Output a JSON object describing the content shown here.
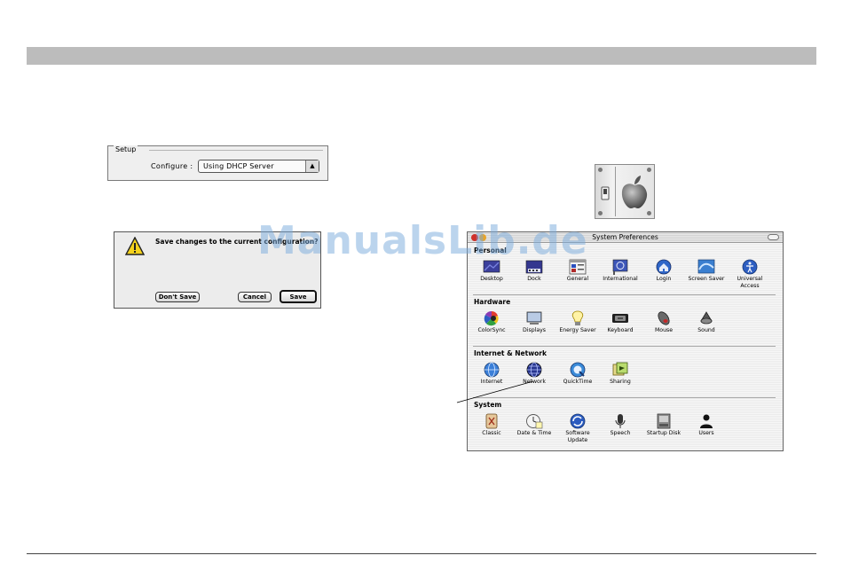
{
  "watermark": "ManualsLib.de",
  "setup": {
    "legend": "Setup",
    "configure_label": "Configure :",
    "configure_value": "Using DHCP Server"
  },
  "alert": {
    "message": "Save changes to the current configuration?",
    "dont_save": "Don't Save",
    "cancel": "Cancel",
    "save": "Save"
  },
  "sysprefs": {
    "title": "System Preferences",
    "sections": [
      {
        "title": "Personal",
        "items": [
          {
            "label": "Desktop",
            "icon": "desktop-icon"
          },
          {
            "label": "Dock",
            "icon": "dock-icon"
          },
          {
            "label": "General",
            "icon": "general-icon"
          },
          {
            "label": "International",
            "icon": "international-icon"
          },
          {
            "label": "Login",
            "icon": "login-icon"
          },
          {
            "label": "Screen Saver",
            "icon": "screen-saver-icon"
          },
          {
            "label": "Universal Access",
            "icon": "universal-access-icon"
          }
        ]
      },
      {
        "title": "Hardware",
        "items": [
          {
            "label": "ColorSync",
            "icon": "colorsync-icon"
          },
          {
            "label": "Displays",
            "icon": "displays-icon"
          },
          {
            "label": "Energy Saver",
            "icon": "energy-saver-icon"
          },
          {
            "label": "Keyboard",
            "icon": "keyboard-icon"
          },
          {
            "label": "Mouse",
            "icon": "mouse-icon"
          },
          {
            "label": "Sound",
            "icon": "sound-icon"
          }
        ]
      },
      {
        "title": "Internet & Network",
        "items": [
          {
            "label": "Internet",
            "icon": "internet-icon"
          },
          {
            "label": "Network",
            "icon": "network-icon"
          },
          {
            "label": "QuickTime",
            "icon": "quicktime-icon"
          },
          {
            "label": "Sharing",
            "icon": "sharing-icon"
          }
        ]
      },
      {
        "title": "System",
        "items": [
          {
            "label": "Classic",
            "icon": "classic-icon"
          },
          {
            "label": "Date & Time",
            "icon": "date-time-icon"
          },
          {
            "label": "Software Update",
            "icon": "software-update-icon"
          },
          {
            "label": "Speech",
            "icon": "speech-icon"
          },
          {
            "label": "Startup Disk",
            "icon": "startup-disk-icon"
          },
          {
            "label": "Users",
            "icon": "users-icon"
          }
        ]
      }
    ]
  }
}
